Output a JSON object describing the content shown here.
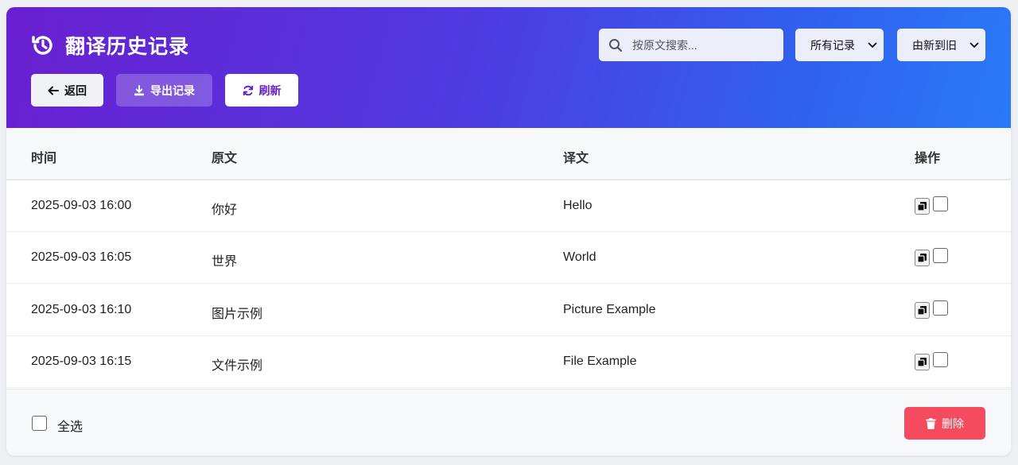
{
  "header": {
    "title": "翻译历史记录",
    "back_label": "返回",
    "export_label": "导出记录",
    "refresh_label": "刷新",
    "search_placeholder": "按原文搜索...",
    "filter_selected": "所有记录",
    "sort_selected": "由新到旧"
  },
  "table": {
    "columns": [
      "时间",
      "原文",
      "译文",
      "操作"
    ],
    "rows": [
      {
        "time": "2025-09-03 16:00",
        "source": "你好",
        "translation": "Hello"
      },
      {
        "time": "2025-09-03 16:05",
        "source": "世界",
        "translation": "World"
      },
      {
        "time": "2025-09-03 16:10",
        "source": "图片示例",
        "translation": "Picture Example"
      },
      {
        "time": "2025-09-03 16:15",
        "source": "文件示例",
        "translation": "File Example"
      }
    ]
  },
  "footer": {
    "select_all_label": "全选",
    "delete_label": "删除"
  },
  "colors": {
    "header_gradient_start": "#6a1fd0",
    "header_gradient_end": "#2a7af7",
    "delete": "#f44c5e",
    "refresh_text": "#6a22c9"
  },
  "icons": [
    "history-icon",
    "arrow-left-icon",
    "download-icon",
    "refresh-icon",
    "search-icon",
    "chevron-down-icon",
    "copy-icon",
    "trash-icon"
  ]
}
